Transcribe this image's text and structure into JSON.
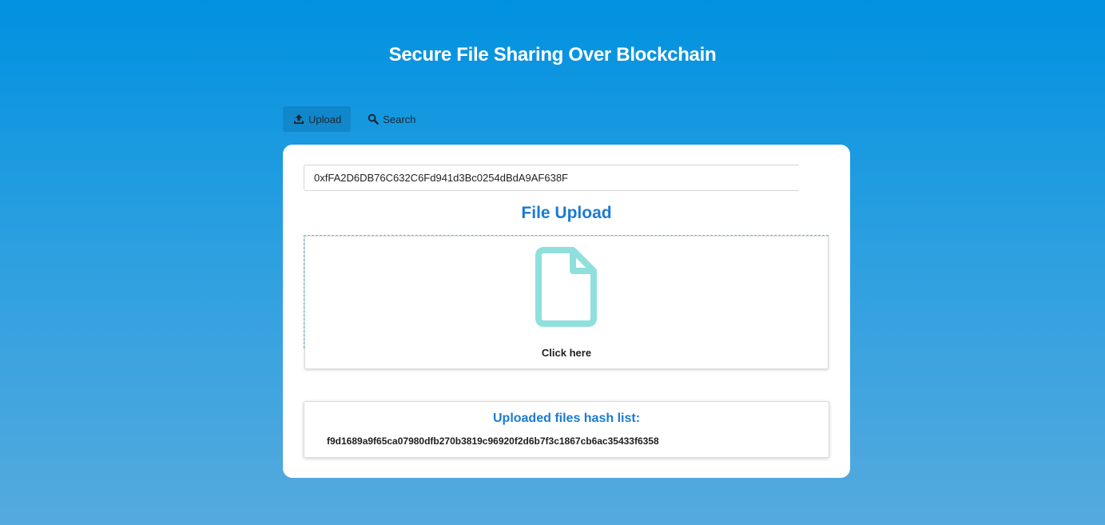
{
  "app": {
    "title": "Secure File Sharing Over Blockchain"
  },
  "tabs": [
    {
      "label": "Upload",
      "icon": "upload-icon",
      "active": true
    },
    {
      "label": "Search",
      "icon": "search-icon",
      "active": false
    }
  ],
  "account": {
    "address_value": "0xfFA2D6DB76C632C6Fd941d3Bc0254dBdA9AF638F"
  },
  "upload": {
    "heading": "File Upload",
    "dropzone_label": "Click here",
    "icon": "file-icon"
  },
  "hash_list": {
    "heading": "Uploaded files hash list:",
    "items": [
      "f9d1689a9f65ca07980dfb270b3819c96920f2d6b7f3c1867cb6ac35433f6358"
    ]
  },
  "colors": {
    "background_top": "#0091e0",
    "background_bottom": "#55aade",
    "accent": "#1a7bd0",
    "file_icon": "#8fe0dc"
  }
}
